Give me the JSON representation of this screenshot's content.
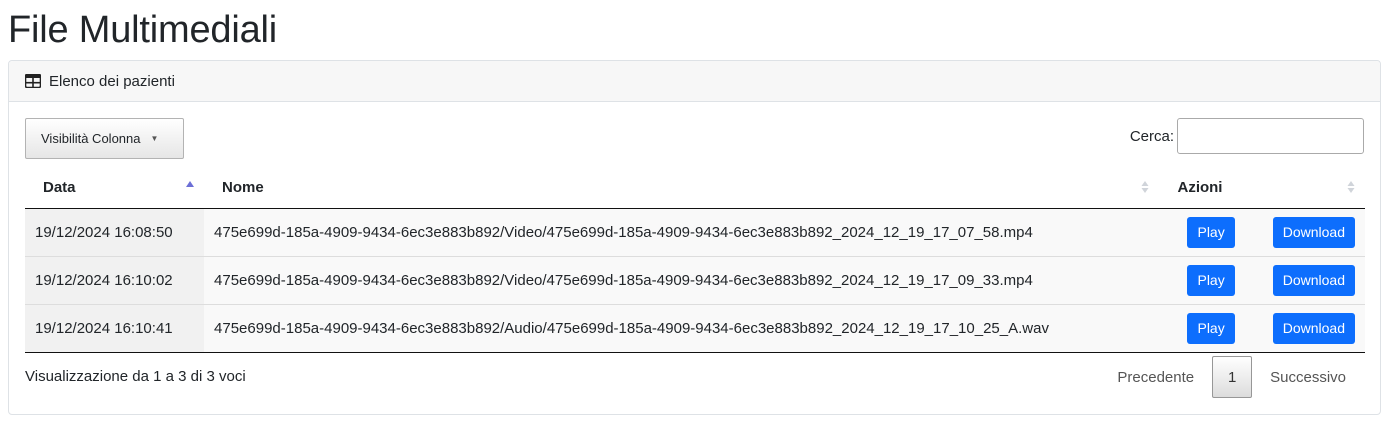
{
  "page": {
    "title": "File Multimediali"
  },
  "card": {
    "header_title": "Elenco dei pazienti",
    "header_icon": "table-icon"
  },
  "toolbar": {
    "colvis_label": "Visibilità Colonna",
    "search_label": "Cerca:",
    "search_value": ""
  },
  "table": {
    "columns": [
      "Data",
      "Nome",
      "Azioni"
    ],
    "sorted_column": "Data",
    "sort_direction": "asc",
    "rows": [
      {
        "date": "19/12/2024 16:08:50",
        "name": "475e699d-185a-4909-9434-6ec3e883b892/Video/475e699d-185a-4909-9434-6ec3e883b892_2024_12_19_17_07_58.mp4",
        "play": "Play",
        "download": "Download"
      },
      {
        "date": "19/12/2024 16:10:02",
        "name": "475e699d-185a-4909-9434-6ec3e883b892/Video/475e699d-185a-4909-9434-6ec3e883b892_2024_12_19_17_09_33.mp4",
        "play": "Play",
        "download": "Download"
      },
      {
        "date": "19/12/2024 16:10:41",
        "name": "475e699d-185a-4909-9434-6ec3e883b892/Audio/475e699d-185a-4909-9434-6ec3e883b892_2024_12_19_17_10_25_A.wav",
        "play": "Play",
        "download": "Download"
      }
    ]
  },
  "footer": {
    "info": "Visualizzazione da 1 a 3 di 3 voci",
    "prev_label": "Precedente",
    "current_page": "1",
    "next_label": "Successivo"
  },
  "colors": {
    "primary_button": "#0d6efd",
    "sort_active": "#6c6fd6",
    "sort_inactive": "#d0d4da"
  }
}
